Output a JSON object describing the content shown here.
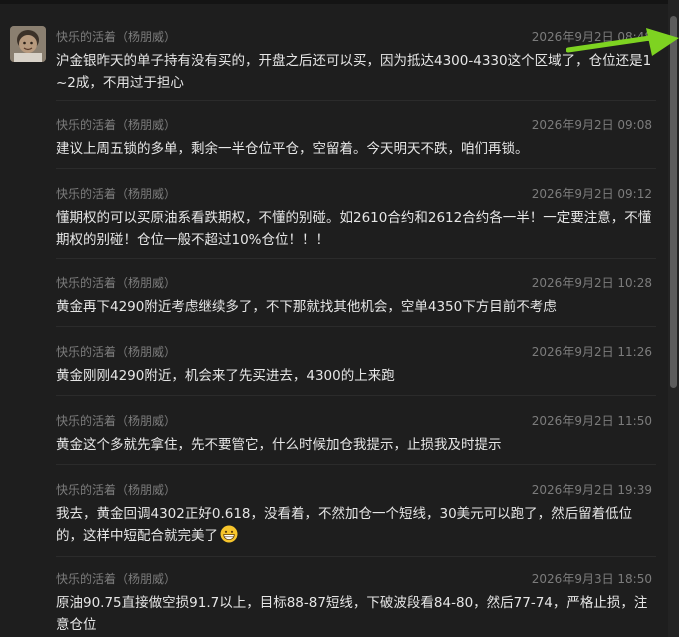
{
  "avatar_icon": "child-photo-avatar",
  "messages": [
    {
      "author": "快乐的活着（杨朋威）",
      "time": "2026年9月2日 08:48",
      "text": "沪金银昨天的单子持有没有买的，开盘之后还可以买，因为抵达4300-4330这个区域了，仓位还是1~2成，不用过于担心"
    },
    {
      "author": "快乐的活着（杨朋威）",
      "time": "2026年9月2日 09:08",
      "text": "建议上周五锁的多单，剩余一半仓位平仓，空留着。今天明天不跌，咱们再锁。"
    },
    {
      "author": "快乐的活着（杨朋威）",
      "time": "2026年9月2日 09:12",
      "text": "懂期权的可以买原油系看跌期权，不懂的别碰。如2610合约和2612合约各一半！一定要注意，不懂期权的别碰！仓位一般不超过10%仓位！！！"
    },
    {
      "author": "快乐的活着（杨朋威）",
      "time": "2026年9月2日 10:28",
      "text": "黄金再下4290附近考虑继续多了，不下那就找其他机会，空单4350下方目前不考虑"
    },
    {
      "author": "快乐的活着（杨朋威）",
      "time": "2026年9月2日 11:26",
      "text": "黄金刚刚4290附近，机会来了先买进去，4300的上来跑"
    },
    {
      "author": "快乐的活着（杨朋威）",
      "time": "2026年9月2日 11:50",
      "text": "黄金这个多就先拿住，先不要管它，什么时候加仓我提示，止损我及时提示"
    },
    {
      "author": "快乐的活着（杨朋威）",
      "time": "2026年9月2日 19:39",
      "text": "我去，黄金回调4302正好0.618，没看着，不然加仓一个短线，30美元可以跑了，然后留着低位的，这样中短配合就完美了",
      "emoji": "grinning-face-icon"
    },
    {
      "author": "快乐的活着（杨朋威）",
      "time": "2026年9月3日 18:50",
      "text": "原油90.75直接做空损91.7以上，目标88-87短线，下破波段看84-80，然后77-74，严格止损，注意仓位"
    }
  ],
  "colors": {
    "background": "#1e1e1e",
    "meta_text": "#7c7c7c",
    "body_text": "#e6e6e6",
    "arrow": "#7ed321"
  }
}
